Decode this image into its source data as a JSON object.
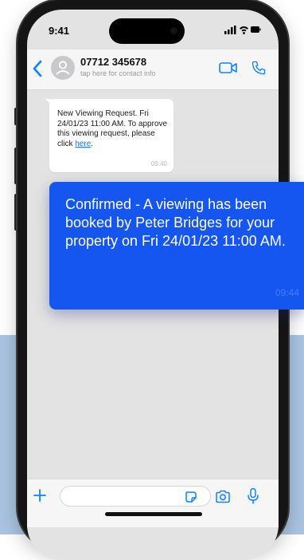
{
  "status_bar": {
    "time": "9:41"
  },
  "header": {
    "contact_name": "07712 345678",
    "contact_subtitle": "tap here for contact info"
  },
  "incoming_message": {
    "text": "New Viewing Request. Fri 24/01/23 11:00 AM. To approve this viewing request, please click ",
    "link_text": "here",
    "after_link": ".",
    "time": "09:40"
  },
  "confirmation_card": {
    "text": "Confirmed - A viewing has been booked by Peter Bridges for your property on Fri 24/01/23 11:00 AM.",
    "time": "09:44"
  },
  "colors": {
    "accent": "#1456ef",
    "link": "#1a73e8",
    "ios_blue": "#0a84ff",
    "chat_background": "#e3e3e3",
    "page_band": "#a9c4e2"
  },
  "icons": [
    "chevron-left-icon",
    "avatar-person-icon",
    "video-call-icon",
    "phone-call-icon",
    "plus-icon",
    "sticker-icon",
    "camera-icon",
    "microphone-icon",
    "signal-icon",
    "wifi-icon",
    "battery-icon"
  ]
}
